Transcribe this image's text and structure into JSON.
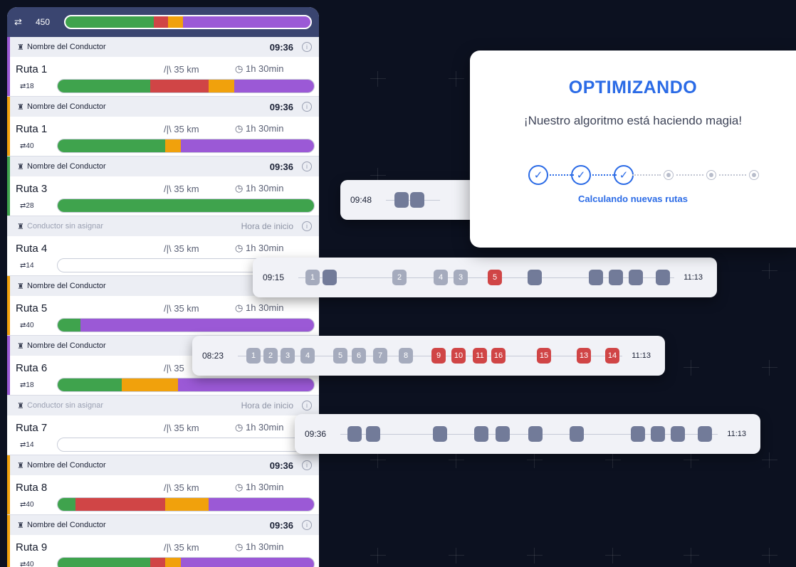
{
  "colors": {
    "green": "#3fa34d",
    "red": "#d04546",
    "orange": "#f1a10c",
    "purple": "#9b59d6",
    "accent_blue": "#2b6be6"
  },
  "header": {
    "icon": "swap-arrows-icon",
    "count": "450",
    "progress": [
      {
        "color": "green",
        "share": 0.36
      },
      {
        "color": "red",
        "share": 0.06
      },
      {
        "color": "orange",
        "share": 0.06
      },
      {
        "color": "purple",
        "share": 0.52
      }
    ]
  },
  "routes": [
    {
      "driver": "Nombre del Conductor",
      "time": "09:36",
      "route": "Ruta 1",
      "distance": "35 km",
      "duration": "1h 30min",
      "stops": "18",
      "accent": "#9b59d6",
      "assigned": true,
      "progress": [
        {
          "color": "green",
          "share": 0.36
        },
        {
          "color": "red",
          "share": 0.23
        },
        {
          "color": "orange",
          "share": 0.1
        },
        {
          "color": "purple",
          "share": 0.31
        }
      ]
    },
    {
      "driver": "Nombre del Conductor",
      "time": "09:36",
      "route": "Ruta 1",
      "distance": "35 km",
      "duration": "1h 30min",
      "stops": "40",
      "accent": "#f1a10c",
      "assigned": true,
      "progress": [
        {
          "color": "green",
          "share": 0.42
        },
        {
          "color": "orange",
          "share": 0.06
        },
        {
          "color": "purple",
          "share": 0.52
        }
      ]
    },
    {
      "driver": "Nombre del Conductor",
      "time": "09:36",
      "route": "Ruta 3",
      "distance": "35 km",
      "duration": "1h 30min",
      "stops": "28",
      "accent": "#3fa34d",
      "assigned": true,
      "progress": [
        {
          "color": "green",
          "share": 1.0
        }
      ]
    },
    {
      "driver": "Conductor sin asignar",
      "time": "Hora de inicio",
      "route": "Ruta 4",
      "distance": "35 km",
      "duration": "1h 30min",
      "stops": "14",
      "accent": "transparent",
      "assigned": false,
      "progress": []
    },
    {
      "driver": "Nombre del Conductor",
      "time": "",
      "route": "Ruta 5",
      "distance": "35 km",
      "duration": "1h 30min",
      "stops": "40",
      "accent": "#f1a10c",
      "assigned": true,
      "progress": [
        {
          "color": "green",
          "share": 0.09
        },
        {
          "color": "purple",
          "share": 0.91
        }
      ]
    },
    {
      "driver": "Nombre del Conductor",
      "time": "",
      "route": "Ruta 6",
      "distance": "35",
      "duration": "",
      "stops": "18",
      "accent": "#9b59d6",
      "assigned": true,
      "progress": [
        {
          "color": "green",
          "share": 0.25
        },
        {
          "color": "orange",
          "share": 0.22
        },
        {
          "color": "purple",
          "share": 0.53
        }
      ]
    },
    {
      "driver": "Conductor sin asignar",
      "time": "Hora de inicio",
      "route": "Ruta 7",
      "distance": "35 km",
      "duration": "1h 30min",
      "stops": "14",
      "accent": "transparent",
      "assigned": false,
      "progress": []
    },
    {
      "driver": "Nombre del Conductor",
      "time": "09:36",
      "route": "Ruta 8",
      "distance": "35 km",
      "duration": "1h 30min",
      "stops": "40",
      "accent": "#f1a10c",
      "assigned": true,
      "progress": [
        {
          "color": "green",
          "share": 0.07
        },
        {
          "color": "red",
          "share": 0.35
        },
        {
          "color": "orange",
          "share": 0.17
        },
        {
          "color": "purple",
          "share": 0.41
        }
      ]
    },
    {
      "driver": "Nombre del Conductor",
      "time": "09:36",
      "route": "Ruta 9",
      "distance": "35 km",
      "duration": "1h 30min",
      "stops": "40",
      "accent": "#f1a10c",
      "assigned": true,
      "progress": [
        {
          "color": "green",
          "share": 0.36
        },
        {
          "color": "red",
          "share": 0.06
        },
        {
          "color": "orange",
          "share": 0.06
        },
        {
          "color": "purple",
          "share": 0.52
        }
      ]
    }
  ],
  "timelines": [
    {
      "start": "09:48",
      "end": "",
      "blocks": [
        {
          "label": "",
          "tone": "dark"
        },
        {
          "label": "",
          "tone": "dark"
        }
      ]
    },
    {
      "start": "09:15",
      "end": "11:13",
      "blocks": [
        {
          "label": "1",
          "tone": "light"
        },
        {
          "label": "",
          "tone": "dark"
        },
        {
          "label": "2",
          "tone": "light"
        },
        {
          "label": "4",
          "tone": "light"
        },
        {
          "label": "3",
          "tone": "light"
        },
        {
          "label": "5",
          "tone": "red"
        },
        {
          "label": "",
          "tone": "dark"
        },
        {
          "label": "",
          "tone": "dark"
        },
        {
          "label": "",
          "tone": "dark"
        },
        {
          "label": "",
          "tone": "dark"
        },
        {
          "label": "",
          "tone": "dark"
        }
      ]
    },
    {
      "start": "08:23",
      "end": "11:13",
      "blocks": [
        {
          "label": "1",
          "tone": "light"
        },
        {
          "label": "2",
          "tone": "light"
        },
        {
          "label": "3",
          "tone": "light"
        },
        {
          "label": "4",
          "tone": "light"
        },
        {
          "label": "5",
          "tone": "light"
        },
        {
          "label": "6",
          "tone": "light"
        },
        {
          "label": "7",
          "tone": "light"
        },
        {
          "label": "8",
          "tone": "light"
        },
        {
          "label": "9",
          "tone": "red"
        },
        {
          "label": "10",
          "tone": "red"
        },
        {
          "label": "11",
          "tone": "red"
        },
        {
          "label": "16",
          "tone": "red"
        },
        {
          "label": "15",
          "tone": "red"
        },
        {
          "label": "13",
          "tone": "red"
        },
        {
          "label": "14",
          "tone": "red"
        }
      ]
    },
    {
      "start": "09:36",
      "end": "11:13",
      "blocks": [
        {
          "label": "",
          "tone": "dark"
        },
        {
          "label": "",
          "tone": "dark"
        },
        {
          "label": "",
          "tone": "dark"
        },
        {
          "label": "",
          "tone": "dark"
        },
        {
          "label": "",
          "tone": "dark"
        },
        {
          "label": "",
          "tone": "dark"
        },
        {
          "label": "",
          "tone": "dark"
        },
        {
          "label": "",
          "tone": "dark"
        },
        {
          "label": "",
          "tone": "dark"
        },
        {
          "label": "",
          "tone": "dark"
        },
        {
          "label": "",
          "tone": "dark"
        }
      ]
    }
  ],
  "modal": {
    "title": "OPTIMIZANDO",
    "subtitle": "¡Nuestro algoritmo está haciendo magia!",
    "status": "Calculando nuevas rutas",
    "steps_done": 3,
    "steps_total": 6
  }
}
